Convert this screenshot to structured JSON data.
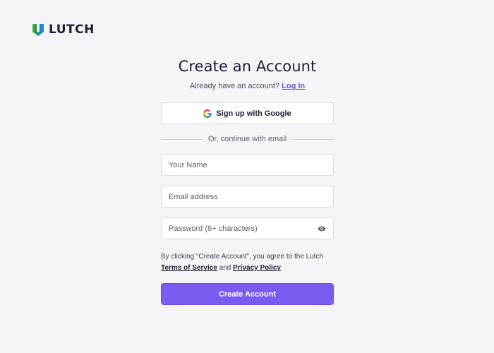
{
  "brand": {
    "name": "LUTCH",
    "logo_icon": "lutch-shield-icon",
    "colors": {
      "mark_green": "#3fae49",
      "mark_blue": "#1e88c9",
      "mark_dark": "#1c6b3a"
    }
  },
  "header": {
    "title": "Create an Account",
    "subtitle_text": "Already have an account?",
    "login_link": "Log In"
  },
  "google_button": {
    "label": "Sign up with Google",
    "icon": "google-icon"
  },
  "divider": {
    "text": "Or, continue with email"
  },
  "fields": {
    "name": {
      "placeholder": "Your Name",
      "value": ""
    },
    "email": {
      "placeholder": "Email address",
      "value": ""
    },
    "password": {
      "placeholder": "Password (6+ characters)",
      "value": "",
      "toggle_icon": "eye-icon"
    }
  },
  "terms": {
    "prefix": "By clicking “Create Account”, you agree to the Lutch",
    "tos_link": "Terms of Service",
    "conjunction": "and",
    "privacy_link": "Privacy Policy"
  },
  "submit": {
    "label": "Create Account",
    "color": "#7b5cf0"
  },
  "theme": {
    "background": "#f5f5f8",
    "link_color": "#6a4fe0"
  }
}
